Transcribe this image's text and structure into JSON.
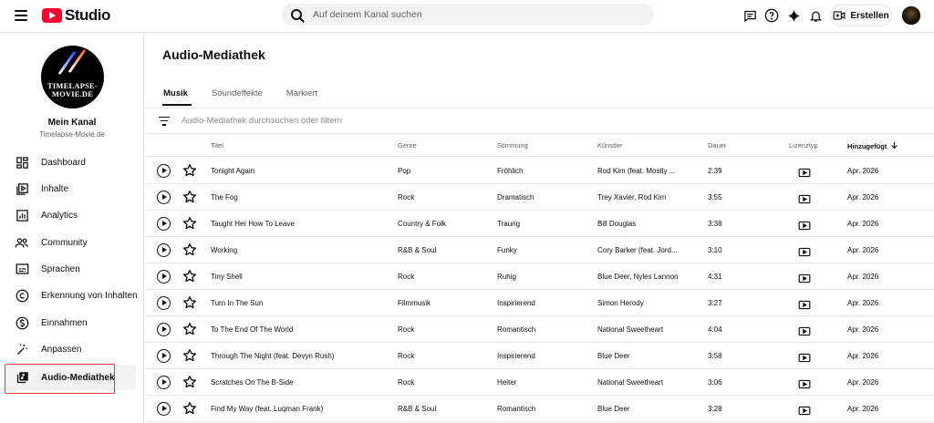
{
  "header": {
    "logo_text": "Studio",
    "search_placeholder": "Auf deinem Kanal suchen",
    "create_label": "Erstellen",
    "icons": [
      "menu-icon",
      "youtube-logo-icon",
      "search-icon",
      "feedback-icon",
      "help-icon",
      "sparkle-icon",
      "bell-icon",
      "create-video-icon"
    ]
  },
  "sidebar": {
    "channel_name": "Mein Kanal",
    "channel_handle": "Timelapse-Movie.de",
    "avatar_text": [
      "TIMELAPSE-",
      "MOVIE.DE"
    ],
    "items": [
      {
        "label": "Dashboard",
        "icon": "dashboard-icon"
      },
      {
        "label": "Inhalte",
        "icon": "content-icon"
      },
      {
        "label": "Analytics",
        "icon": "analytics-icon"
      },
      {
        "label": "Community",
        "icon": "community-icon"
      },
      {
        "label": "Sprachen",
        "icon": "subtitles-icon"
      },
      {
        "label": "Erkennung von Inhalten",
        "icon": "copyright-icon"
      },
      {
        "label": "Einnahmen",
        "icon": "dollar-icon"
      },
      {
        "label": "Anpassen",
        "icon": "magic-wand-icon"
      },
      {
        "label": "Audio-Mediathek",
        "icon": "audio-library-icon",
        "active": true
      }
    ]
  },
  "main": {
    "title": "Audio-Mediathek",
    "tabs": [
      {
        "label": "Musik",
        "active": true
      },
      {
        "label": "Soundeffekte",
        "active": false
      },
      {
        "label": "Markiert",
        "active": false
      }
    ],
    "filter_placeholder": "Audio-Mediathek durchsuchen oder filtern",
    "columns": {
      "title": "Titel",
      "genre": "Genre",
      "mood": "Stimmung",
      "artist": "Künstler",
      "duration": "Dauer",
      "license": "Lizenztyp",
      "added": "Hinzugefügt",
      "sort_direction": "descending"
    },
    "rows": [
      {
        "title": "Tonight Again",
        "genre": "Pop",
        "mood": "Fröhlich",
        "artist": "Rod Kim (feat. Mostly ...",
        "duration": "2:39",
        "added": "Apr. 2026"
      },
      {
        "title": "The Fog",
        "genre": "Rock",
        "mood": "Dramatisch",
        "artist": "Trey Xavier, Rod Kim",
        "duration": "3:55",
        "added": "Apr. 2026"
      },
      {
        "title": "Taught Her How To Leave",
        "genre": "Country & Folk",
        "mood": "Traurig",
        "artist": "Bill Douglas",
        "duration": "3:38",
        "added": "Apr. 2026"
      },
      {
        "title": "Working",
        "genre": "R&B & Soul",
        "mood": "Funky",
        "artist": "Cory Barker (feat. Jord...",
        "duration": "3:10",
        "added": "Apr. 2026"
      },
      {
        "title": "Tiny Shell",
        "genre": "Rock",
        "mood": "Ruhig",
        "artist": "Blue Deer, Nyles Lannon",
        "duration": "4:31",
        "added": "Apr. 2026"
      },
      {
        "title": "Turn In The Sun",
        "genre": "Filmmusik",
        "mood": "Inspirierend",
        "artist": "Simon Herody",
        "duration": "3:27",
        "added": "Apr. 2026"
      },
      {
        "title": "To The End Of The World",
        "genre": "Rock",
        "mood": "Romantisch",
        "artist": "National Sweetheart",
        "duration": "4:04",
        "added": "Apr. 2026"
      },
      {
        "title": "Through The Night (feat. Devyn Rush)",
        "genre": "Rock",
        "mood": "Inspirierend",
        "artist": "Blue Deer",
        "duration": "3:58",
        "added": "Apr. 2026"
      },
      {
        "title": "Scratches On The B-Side",
        "genre": "Rock",
        "mood": "Heiter",
        "artist": "National Sweetheart",
        "duration": "3:06",
        "added": "Apr. 2026"
      },
      {
        "title": "Find My Way (feat. Luqman Frank)",
        "genre": "R&B & Soul",
        "mood": "Romantisch",
        "artist": "Blue Deer",
        "duration": "3:28",
        "added": "Apr. 2026"
      }
    ]
  },
  "colors": {
    "brand_red": "#ff0033",
    "highlight_red": "#e53935",
    "text": "#0f0f0f",
    "secondary_text": "#606060",
    "divider": "#e5e5e5"
  }
}
